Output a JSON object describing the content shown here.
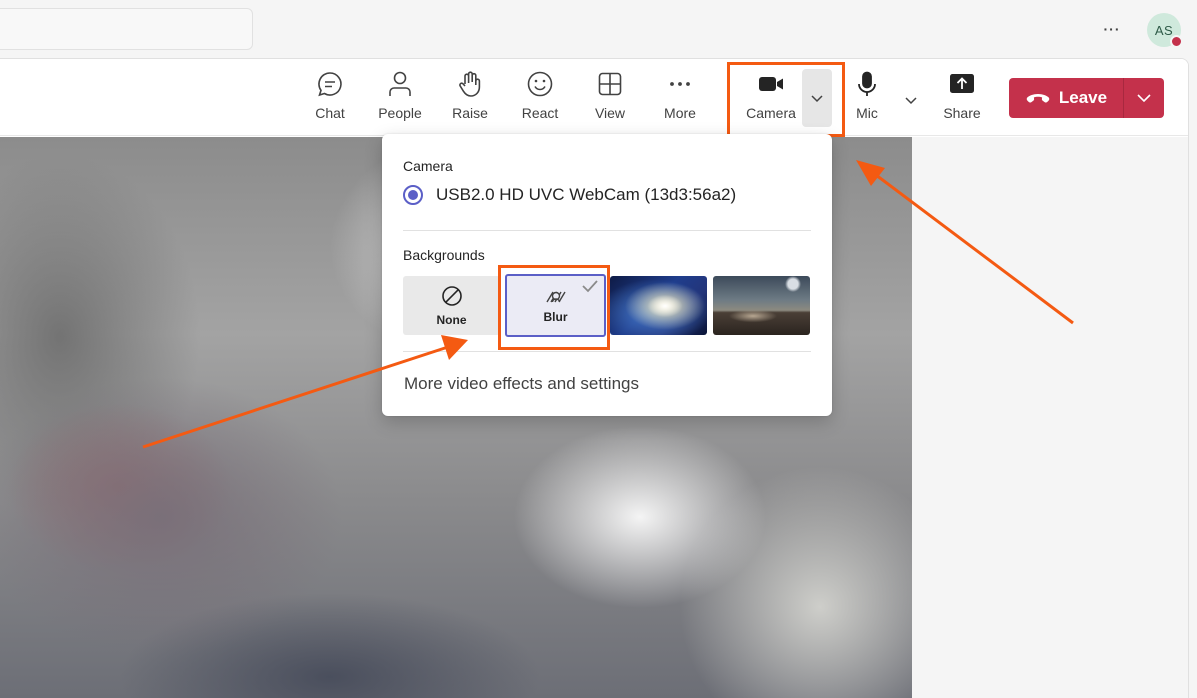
{
  "titlebar": {
    "more_glyph": "···",
    "avatar_initials": "AS"
  },
  "toolbar": {
    "chat": "Chat",
    "people": "People",
    "raise": "Raise",
    "react": "React",
    "view": "View",
    "more": "More",
    "camera": "Camera",
    "mic": "Mic",
    "share": "Share",
    "leave": "Leave"
  },
  "flyout": {
    "camera_heading": "Camera",
    "camera_device": "USB2.0 HD UVC WebCam (13d3:56a2)",
    "backgrounds_heading": "Backgrounds",
    "tiles": {
      "none": "None",
      "blur": "Blur"
    },
    "selected_background": "Blur",
    "more_effects": "More video effects and settings"
  },
  "colors": {
    "accent": "#5b5fc7",
    "leave_red": "#c4314b",
    "annotation_orange": "#f45a12"
  }
}
